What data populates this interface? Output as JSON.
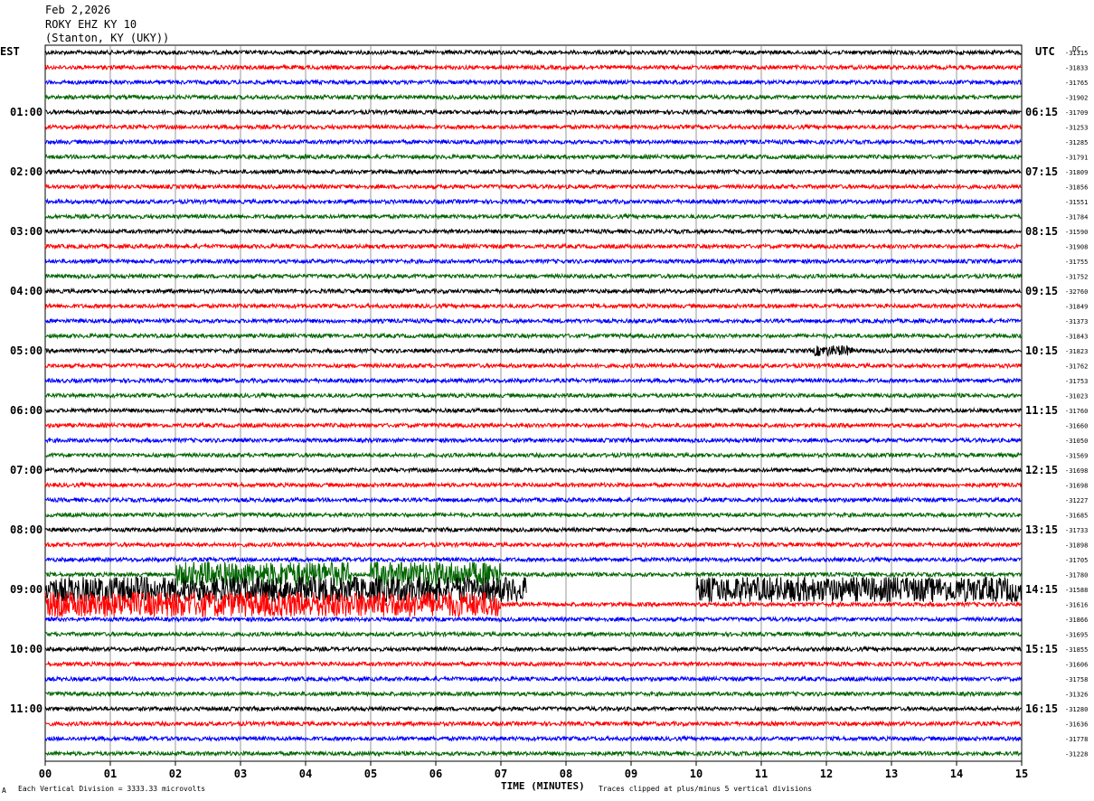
{
  "header": {
    "date": "Feb 2,2026",
    "station": "ROKY EHZ KY 10",
    "location": "(Stanton, KY (UKY))"
  },
  "left_axis_label": "EST",
  "right_axis_label": "UTC",
  "dc_label": "DC",
  "footer": {
    "marker": "A",
    "scale_note": "Each Vertical Division = 3333.33 microvolts",
    "xaxis_title": "TIME (MINUTES)",
    "clip_note": "Traces clipped at plus/minus 5 vertical divisions"
  },
  "colors": {
    "trace_cycle": [
      "#000000",
      "#ff0000",
      "#0000ff",
      "#006600"
    ],
    "grid": "#808080"
  },
  "chart_data": {
    "type": "line",
    "title": "ROKY EHZ KY 10",
    "xlabel": "TIME (MINUTES)",
    "ylabel": "",
    "x_range": [
      0,
      15
    ],
    "x_ticks": [
      "00",
      "01",
      "02",
      "03",
      "04",
      "05",
      "06",
      "07",
      "08",
      "09",
      "10",
      "11",
      "12",
      "13",
      "14",
      "15"
    ],
    "left_hour_labels": [
      "01:00",
      "02:00",
      "03:00",
      "04:00",
      "05:00",
      "06:00",
      "07:00",
      "08:00",
      "09:00",
      "10:00",
      "11:00"
    ],
    "right_hour_labels": [
      "06:15",
      "07:15",
      "08:15",
      "09:15",
      "10:15",
      "11:15",
      "12:15",
      "13:15",
      "14:15",
      "15:15",
      "16:15"
    ],
    "hour_label_rows": [
      4,
      8,
      12,
      16,
      20,
      24,
      28,
      32,
      36,
      40,
      44
    ],
    "dc_offsets": [
      "-31315",
      "-31833",
      "-31765",
      "-31902",
      "-31709",
      "-31253",
      "-31285",
      "-31791",
      "-31809",
      "-31856",
      "-31551",
      "-31784",
      "-31590",
      "-31908",
      "-31755",
      "-31752",
      "-32760",
      "-31849",
      "-31373",
      "-31843",
      "-31823",
      "-31762",
      "-31753",
      "-31023",
      "-31760",
      "-31660",
      "-31050",
      "-31569",
      "-31698",
      "-31698",
      "-31227",
      "-31685",
      "-31733",
      "-31898",
      "-31705",
      "-31780",
      "-31588",
      "-31616",
      "-31866",
      "-31695",
      "-31855",
      "-31606",
      "-31758",
      "-31326",
      "-31280",
      "-31636",
      "-31778",
      "-31228"
    ],
    "trace_count": 48,
    "amplitude_notes": [
      {
        "row": 35,
        "type": "clipped",
        "segments": [
          [
            2.0,
            4.7
          ],
          [
            5.0,
            7.0
          ]
        ]
      },
      {
        "row": 36,
        "type": "clipped",
        "segments": [
          [
            0.0,
            7.4
          ],
          [
            10.0,
            15.0
          ]
        ]
      },
      {
        "row": 37,
        "type": "clipped",
        "segments": [
          [
            0.0,
            7.0
          ]
        ]
      },
      {
        "row": 20,
        "type": "event",
        "segments": [
          [
            11.8,
            12.4
          ]
        ]
      }
    ]
  }
}
